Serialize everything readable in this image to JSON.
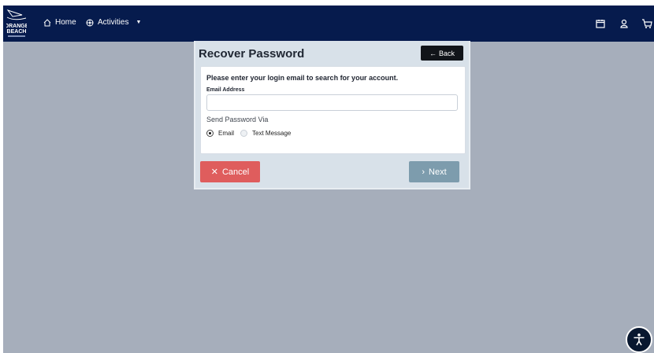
{
  "colors": {
    "navbar": "#061b4d",
    "background": "#a6aebb",
    "cancel": "#df5d5d",
    "next": "#7d9cad",
    "back": "#111419"
  },
  "nav": {
    "logo_icon": "orange-beach-logo",
    "logo_text": "ORANGE BEACH",
    "home_label": "Home",
    "activities_label": "Activities",
    "right_icons": [
      "calendar-icon",
      "user-icon",
      "cart-icon"
    ]
  },
  "panel": {
    "title": "Recover Password",
    "back_label": "Back",
    "prompt": "Please enter your login email to search for your account.",
    "email_label": "Email Address",
    "email_value": "",
    "email_placeholder": "",
    "send_via_label": "Send Password Via",
    "send_options": [
      {
        "label": "Email",
        "selected": true
      },
      {
        "label": "Text Message",
        "selected": false
      }
    ],
    "cancel_label": "Cancel",
    "next_label": "Next"
  },
  "accessibility_icon": "accessibility-icon"
}
